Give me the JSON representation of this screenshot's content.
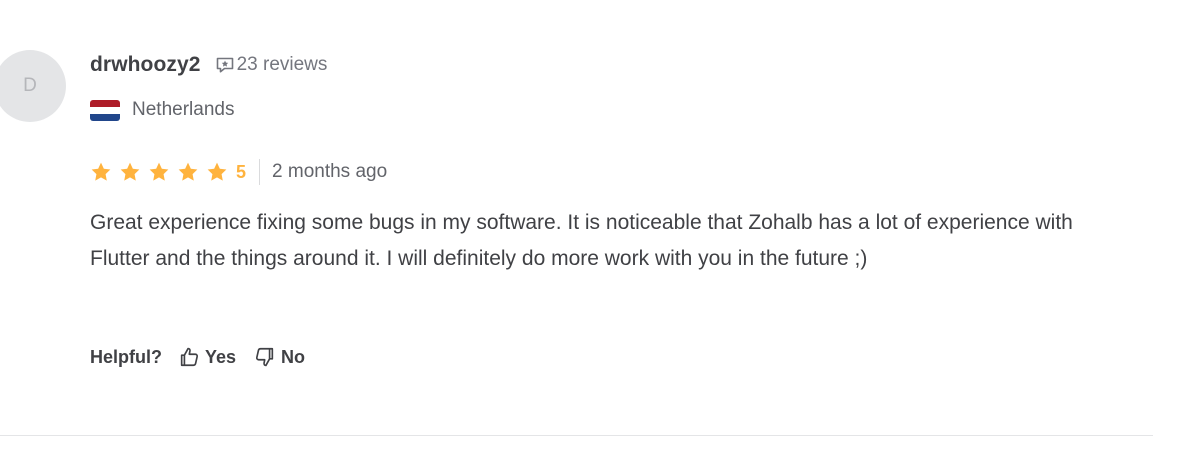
{
  "reviewer": {
    "avatar_initial": "D",
    "username": "drwhoozy2",
    "reviews_count": "23 reviews",
    "country": "Netherlands",
    "flag_colors": [
      "#ae1c28",
      "#ffffff",
      "#21468b"
    ]
  },
  "rating": {
    "value": 5,
    "max": 5,
    "label": "5",
    "star_color": "#ffb33e",
    "time_ago": "2 months ago"
  },
  "review": {
    "text": "Great experience fixing some bugs in my software. It is noticeable that Zohalb has a lot of experience with Flutter and the things around it. I will definitely do more work with you in the future ;)"
  },
  "helpful": {
    "label": "Helpful?",
    "yes_label": "Yes",
    "no_label": "No"
  },
  "icons": {
    "reviews": "review-bubble-icon",
    "star": "star-icon",
    "yes": "thumbs-up-icon",
    "no": "thumbs-down-icon"
  }
}
